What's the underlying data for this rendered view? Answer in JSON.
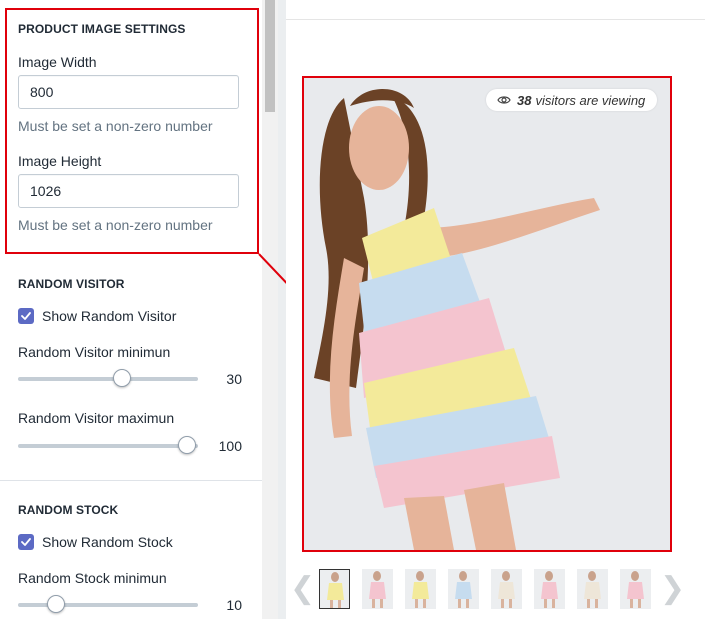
{
  "settings": {
    "image_section": {
      "title": "PRODUCT IMAGE SETTINGS",
      "width_label": "Image Width",
      "width_value": "800",
      "width_help": "Must be set a non-zero number",
      "height_label": "Image Height",
      "height_value": "1026",
      "height_help": "Must be set a non-zero number"
    },
    "random_visitor": {
      "title": "RANDOM VISITOR",
      "checkbox_label": "Show Random Visitor",
      "checked": true,
      "min_label": "Random Visitor minimun",
      "min_value": "30",
      "min_fraction": 0.58,
      "max_label": "Random Visitor maximun",
      "max_value": "100",
      "max_fraction": 0.94
    },
    "random_stock": {
      "title": "RANDOM STOCK",
      "checkbox_label": "Show Random Stock",
      "checked": true,
      "min_label": "Random Stock minimun",
      "min_value": "10",
      "min_fraction": 0.21
    }
  },
  "preview": {
    "heading": "",
    "visitor_badge": {
      "icon": "eye-icon",
      "count": "38",
      "text": "visitors are viewing"
    },
    "thumbnail_count": 8,
    "prev_icon": "chevron-left-icon",
    "next_icon": "chevron-right-icon"
  },
  "colors": {
    "highlight": "#e0000b",
    "checkbox": "#5c6ac4",
    "dress_pink": "#f4c4cf",
    "dress_yellow": "#f3ea9a",
    "dress_blue": "#c6dcef"
  }
}
